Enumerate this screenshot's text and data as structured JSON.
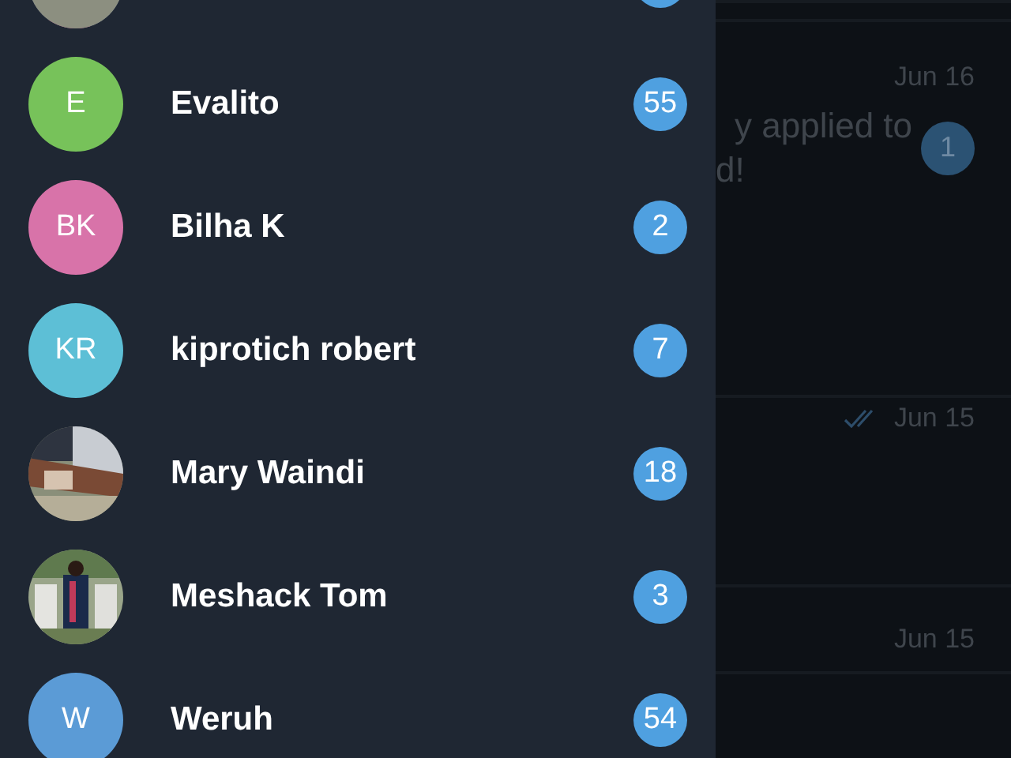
{
  "drawer": {
    "contacts": [
      {
        "badge": {
          "shown": true
        }
      },
      {
        "name": "Evalito",
        "avatar": {
          "kind": "initials",
          "initials": "E",
          "color": "#77c25a"
        },
        "badge": {
          "shown": true,
          "count": "55"
        }
      },
      {
        "name": "Bilha K",
        "avatar": {
          "kind": "initials",
          "initials": "BK",
          "color": "#d873a9"
        },
        "badge": {
          "shown": true,
          "count": "2"
        }
      },
      {
        "name": "kiprotich robert",
        "avatar": {
          "kind": "initials",
          "initials": "KR",
          "color": "#5dbfd6"
        },
        "badge": {
          "shown": true,
          "count": "7"
        }
      },
      {
        "name": "Mary Waindi",
        "badge": {
          "shown": true,
          "count": "18"
        }
      },
      {
        "name": "Meshack Tom",
        "badge": {
          "shown": true,
          "count": "3"
        }
      },
      {
        "name": "Weruh",
        "avatar": {
          "kind": "initials",
          "initials": "W",
          "color": "#5b9bd6"
        },
        "badge": {
          "shown": true,
          "count": "54"
        }
      }
    ]
  },
  "chat_list": [
    {
      "date": "Jun 16",
      "preview_lines": [
        "y applied to",
        "d!"
      ],
      "unread": "1",
      "read_ticks": false
    },
    {
      "date": "Jun 15",
      "read_ticks": true
    },
    {
      "date": "Jun 15",
      "read_ticks": false
    }
  ]
}
